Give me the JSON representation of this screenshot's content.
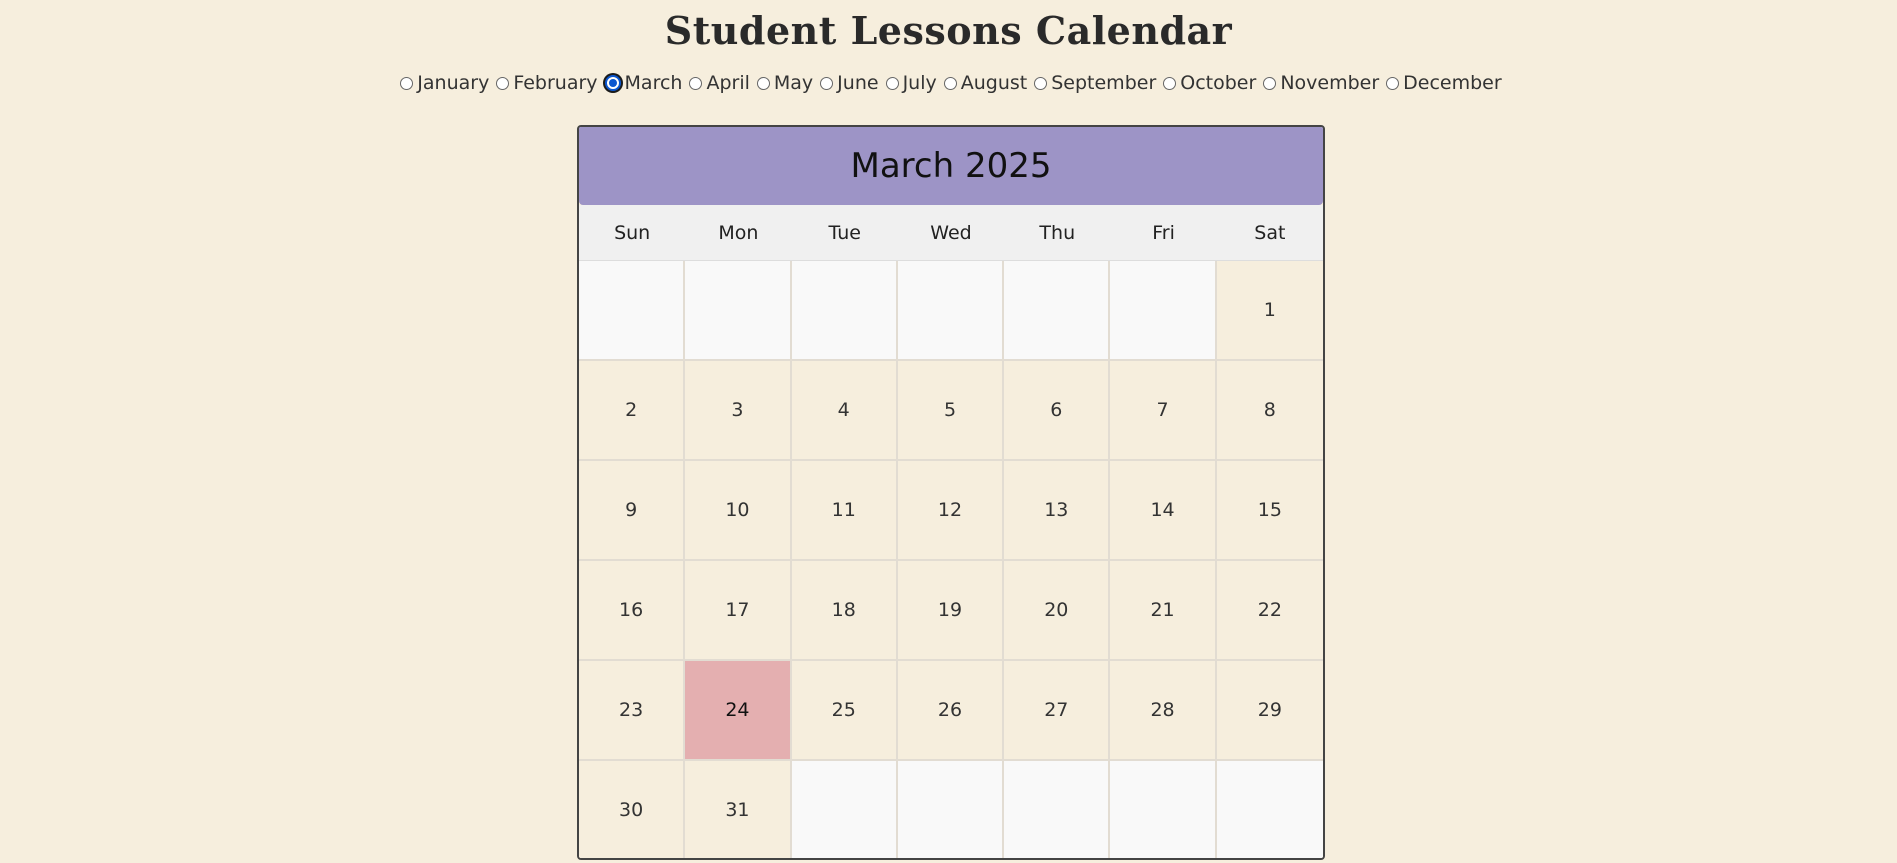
{
  "title": "Student Lessons Calendar",
  "months": [
    {
      "label": "January",
      "checked": false
    },
    {
      "label": "February",
      "checked": false
    },
    {
      "label": "March",
      "checked": true
    },
    {
      "label": "April",
      "checked": false
    },
    {
      "label": "May",
      "checked": false
    },
    {
      "label": "June",
      "checked": false
    },
    {
      "label": "July",
      "checked": false
    },
    {
      "label": "August",
      "checked": false
    },
    {
      "label": "September",
      "checked": false
    },
    {
      "label": "October",
      "checked": false
    },
    {
      "label": "November",
      "checked": false
    },
    {
      "label": "December",
      "checked": false
    }
  ],
  "calendar": {
    "heading": "March 2025",
    "weekdays": [
      "Sun",
      "Mon",
      "Tue",
      "Wed",
      "Thu",
      "Fri",
      "Sat"
    ],
    "cells": [
      "",
      "",
      "",
      "",
      "",
      "",
      "1",
      "2",
      "3",
      "4",
      "5",
      "6",
      "7",
      "8",
      "9",
      "10",
      "11",
      "12",
      "13",
      "14",
      "15",
      "16",
      "17",
      "18",
      "19",
      "20",
      "21",
      "22",
      "23",
      "24",
      "25",
      "26",
      "27",
      "28",
      "29",
      "30",
      "31",
      "",
      "",
      "",
      "",
      ""
    ],
    "highlighted_day": "24"
  },
  "colors": {
    "background": "#f6eedd",
    "header": "#9d94c6",
    "highlight": "#e4afb0",
    "radio_selected": "#0b57d0"
  }
}
